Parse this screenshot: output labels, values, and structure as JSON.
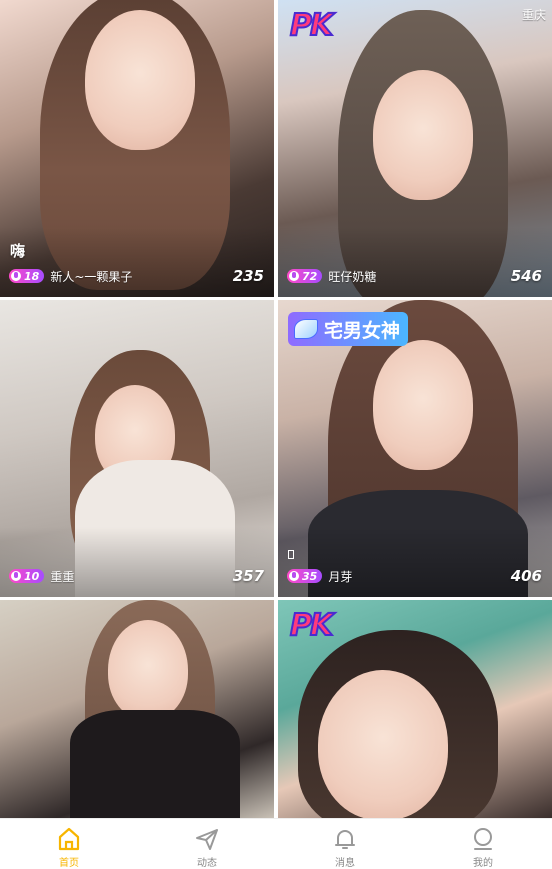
{
  "cards": [
    {
      "caption": "嗨",
      "level": "18",
      "name": "新人~一颗果子",
      "count": "235"
    },
    {
      "city": "重庆",
      "badge": "PK",
      "level": "72",
      "name": "旺仔奶糖",
      "count": "546"
    },
    {
      "level": "10",
      "name": "重重",
      "count": "357"
    },
    {
      "tag": "宅男女神",
      "level": "35",
      "name": "月芽",
      "count": "406"
    },
    {},
    {
      "badge": "PK"
    }
  ],
  "tabs": [
    {
      "label": "首页",
      "icon": "home-icon",
      "active": true
    },
    {
      "label": "动态",
      "icon": "paper-plane-icon"
    },
    {
      "label": "消息",
      "icon": "bell-icon"
    },
    {
      "label": "我的",
      "icon": "profile-icon"
    }
  ],
  "colors": {
    "accent": "#f7b500",
    "level_badge_start": "#ff49c8",
    "level_badge_end": "#a64cff",
    "tag_start": "#8f6bff",
    "tag_end": "#4bb6ff"
  }
}
